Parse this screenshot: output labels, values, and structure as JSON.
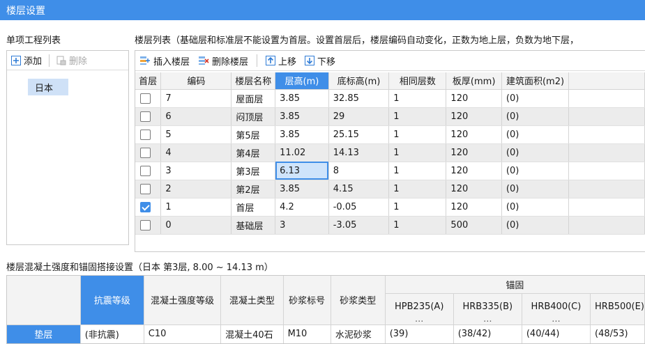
{
  "window": {
    "title": "楼层设置"
  },
  "project_list": {
    "label": "单项工程列表",
    "add_label": "添加",
    "delete_label": "删除",
    "items": [
      "日本"
    ]
  },
  "floor_list": {
    "label": "楼层列表（基础层和标准层不能设置为首层。设置首层后，楼层编码自动变化，正数为地上层，负数为地下层，",
    "toolbar": {
      "insert": "插入楼层",
      "delete": "删除楼层",
      "up": "上移",
      "down": "下移"
    },
    "columns": [
      "首层",
      "编码",
      "楼层名称",
      "层高(m)",
      "底标高(m)",
      "相同层数",
      "板厚(mm)",
      "建筑面积(m2)"
    ],
    "rows": [
      {
        "first": false,
        "code": "7",
        "name": "屋面层",
        "height": "3.85",
        "elev": "32.85",
        "same": "1",
        "slab": "120",
        "area": "(0)"
      },
      {
        "first": false,
        "code": "6",
        "name": "闷顶层",
        "height": "3.85",
        "elev": "29",
        "same": "1",
        "slab": "120",
        "area": "(0)"
      },
      {
        "first": false,
        "code": "5",
        "name": "第5层",
        "height": "3.85",
        "elev": "25.15",
        "same": "1",
        "slab": "120",
        "area": "(0)"
      },
      {
        "first": false,
        "code": "4",
        "name": "第4层",
        "height": "11.02",
        "elev": "14.13",
        "same": "1",
        "slab": "120",
        "area": "(0)"
      },
      {
        "first": false,
        "code": "3",
        "name": "第3层",
        "height": "6.13",
        "elev": "8",
        "same": "1",
        "slab": "120",
        "area": "(0)"
      },
      {
        "first": false,
        "code": "2",
        "name": "第2层",
        "height": "3.85",
        "elev": "4.15",
        "same": "1",
        "slab": "120",
        "area": "(0)"
      },
      {
        "first": true,
        "code": "1",
        "name": "首层",
        "height": "4.2",
        "elev": "-0.05",
        "same": "1",
        "slab": "120",
        "area": "(0)"
      },
      {
        "first": false,
        "code": "0",
        "name": "基础层",
        "height": "3",
        "elev": "-3.05",
        "same": "1",
        "slab": "500",
        "area": "(0)"
      }
    ]
  },
  "concrete_settings": {
    "label": "楼层混凝土强度和锚固搭接设置（日本 第3层, 8.00 ~ 14.13 m）",
    "columns": {
      "seismic_grade": "抗震等级",
      "concrete_grade": "混凝土强度等级",
      "concrete_type": "混凝土类型",
      "mortar_grade": "砂浆标号",
      "mortar_type": "砂浆类型",
      "anchorage": "锚固",
      "anchor_subs": [
        "HPB235(A)",
        "HRB335(B)",
        "HRB400(C)",
        "HRB500(E)"
      ],
      "ellipsis": "..."
    },
    "rows": [
      {
        "name": "垫层",
        "seismic": "(非抗震)",
        "concrete_grade": "C10",
        "concrete_type": "混凝土40石",
        "mortar_grade": "M10",
        "mortar_type": "水泥砂浆",
        "anchors": [
          "(39)",
          "(38/42)",
          "(40/44)",
          "(48/53)"
        ]
      }
    ]
  }
}
